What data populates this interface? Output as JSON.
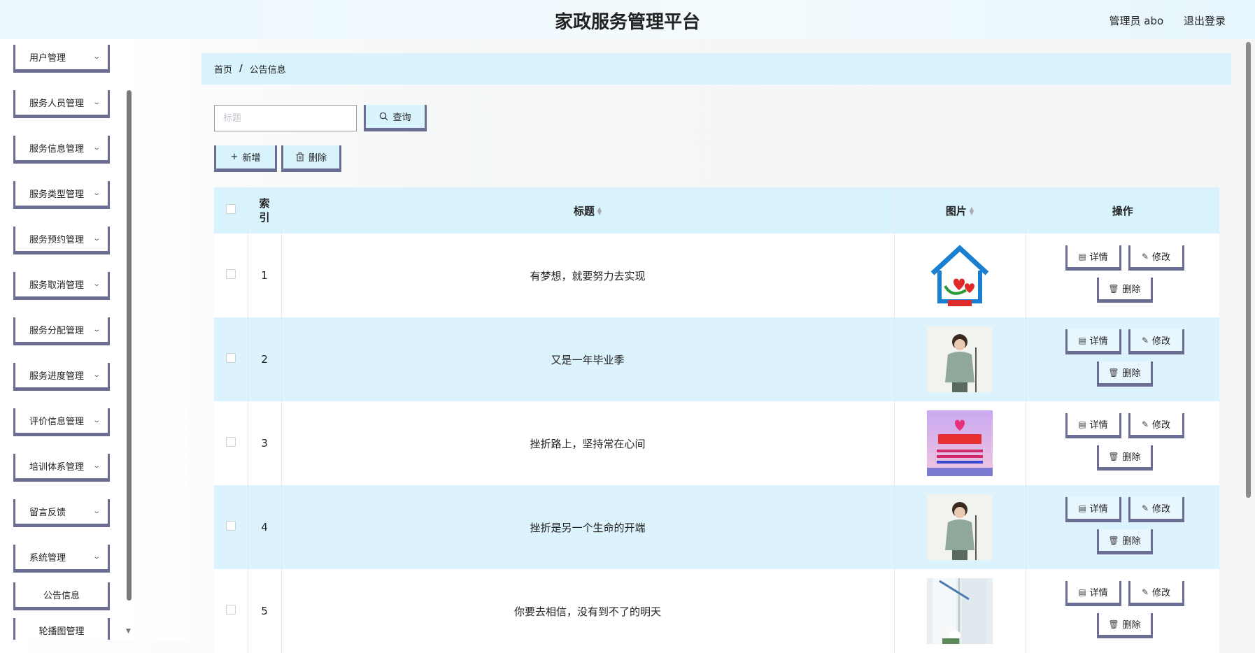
{
  "header": {
    "title": "家政服务管理平台",
    "admin_label": "管理员 abo",
    "logout_label": "退出登录"
  },
  "sidebar": {
    "items": [
      {
        "label": "用户管理"
      },
      {
        "label": "服务人员管理"
      },
      {
        "label": "服务信息管理"
      },
      {
        "label": "服务类型管理"
      },
      {
        "label": "服务预约管理"
      },
      {
        "label": "服务取消管理"
      },
      {
        "label": "服务分配管理"
      },
      {
        "label": "服务进度管理"
      },
      {
        "label": "评价信息管理"
      },
      {
        "label": "培训体系管理"
      },
      {
        "label": "留言反馈"
      },
      {
        "label": "系统管理"
      }
    ],
    "sub_items": [
      {
        "label": "公告信息"
      },
      {
        "label": "轮播图管理"
      }
    ]
  },
  "breadcrumb": {
    "home": "首页",
    "separator": "/",
    "current": "公告信息"
  },
  "search": {
    "placeholder": "标题",
    "value": "",
    "query_label": "查询"
  },
  "actions": {
    "add_label": "新增",
    "delete_label": "删除"
  },
  "table": {
    "headers": {
      "index": "索引",
      "title": "标题",
      "image": "图片",
      "ops": "操作"
    },
    "rows": [
      {
        "index": "1",
        "title": "有梦想，就要努力去实现",
        "image_icon": "house-heart-logo-image"
      },
      {
        "index": "2",
        "title": "又是一年毕业季",
        "image_icon": "housekeeper-photo-image"
      },
      {
        "index": "3",
        "title": "挫折路上，坚持常在心间",
        "image_icon": "housekeeping-poster-image"
      },
      {
        "index": "4",
        "title": "挫折是另一个生命的开端",
        "image_icon": "housekeeper-photo-image"
      },
      {
        "index": "5",
        "title": "你要去相信，没有到不了的明天",
        "image_icon": "window-cleaning-photo-image"
      }
    ],
    "row_actions": {
      "detail": "详情",
      "edit": "修改",
      "remove": "删除"
    }
  },
  "colors": {
    "accent_light": "#d9f3fd",
    "button_border": "#6b6d93"
  }
}
